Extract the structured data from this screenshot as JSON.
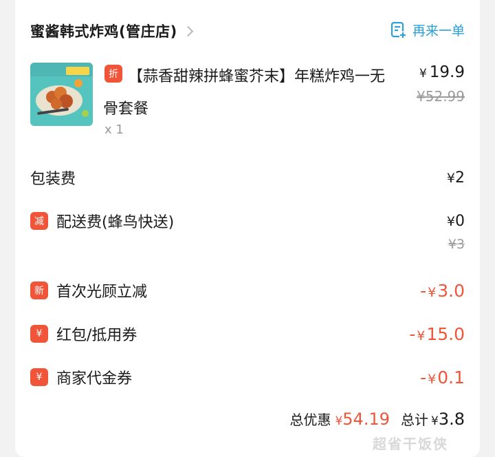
{
  "shop": {
    "name": "蜜酱韩式炸鸡(管庄店)"
  },
  "reorder": {
    "label": "再来一单",
    "icon": "reorder-icon"
  },
  "item": {
    "badge": "折",
    "name": "【蒜香甜辣拼蜂蜜芥末】年糕炸鸡一无骨套餐",
    "quantity": "x 1",
    "currency": "¥",
    "price": "19.9",
    "original_price": "¥52.99"
  },
  "fees": {
    "packaging": {
      "label": "包装费",
      "value": "2"
    },
    "delivery": {
      "badge": "减",
      "label": "配送费(蜂鸟快送)",
      "value": "0",
      "original": "¥3"
    }
  },
  "discounts": [
    {
      "badge": "新",
      "label": "首次光顾立减",
      "sign": "-",
      "value": "3.0"
    },
    {
      "badge": "¥",
      "label": "红包/抵用券",
      "sign": "-",
      "value": "15.0"
    },
    {
      "badge": "¥",
      "label": "商家代金券",
      "sign": "-",
      "value": "0.1"
    }
  ],
  "summary": {
    "discount_label": "总优惠",
    "discount_value": "54.19",
    "total_label": "总计",
    "total_value": "3.8"
  },
  "watermark": "超省干饭侠",
  "colors": {
    "accent_red": "#f0553a",
    "link_blue": "#2a9fd8"
  }
}
